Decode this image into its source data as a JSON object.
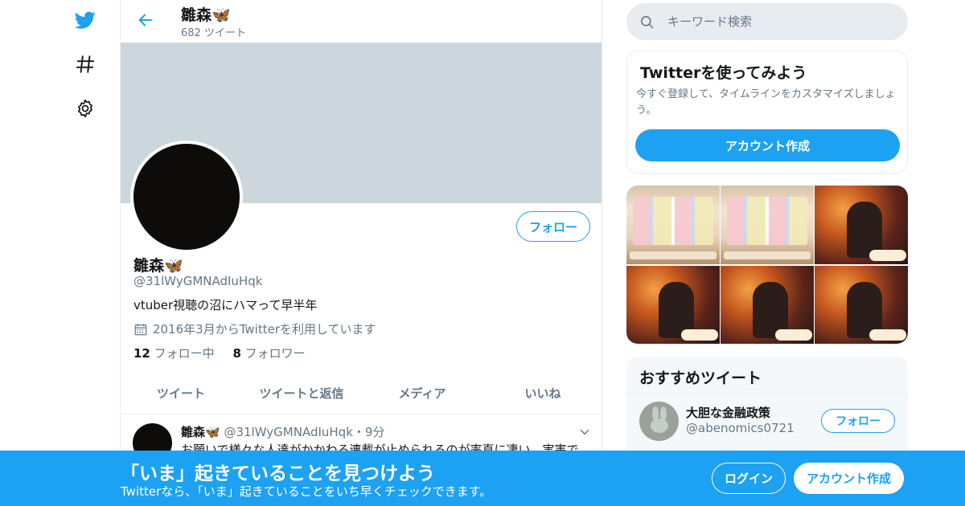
{
  "nav": {
    "items": [
      {
        "icon": "twitter-bird-icon"
      },
      {
        "icon": "hashtag-icon"
      },
      {
        "icon": "gear-icon"
      }
    ]
  },
  "header": {
    "name": "雛森🦋",
    "tweet_count": "682 ツイート"
  },
  "profile": {
    "name": "雛森🦋",
    "handle": "@31lWyGMNAdIuHqk",
    "bio": "vtuber視聴の沼にハマって早半年",
    "joined": "2016年3月からTwitterを利用しています",
    "following_count": "12",
    "following_label": "フォロー中",
    "followers_count": "8",
    "followers_label": "フォロワー",
    "follow_button": "フォロー"
  },
  "tabs": [
    "ツイート",
    "ツイートと返信",
    "メディア",
    "いいね"
  ],
  "tweet": {
    "name": "雛森🦋",
    "handle_time": "@31lWyGMNAdIuHqk・9分",
    "text": "お願いで様々な人達がかかわる連載が止められるのが率直に凄い。実害で"
  },
  "search": {
    "placeholder": "キーワード検索"
  },
  "signup_card": {
    "title": "Twitterを使ってみよう",
    "description": "今すぐ登録して、タイムラインをカスタマイズしましょう。",
    "button": "アカウント作成"
  },
  "media": {
    "tiles": [
      "cards",
      "cards",
      "fire",
      "fire",
      "fire",
      "fire"
    ]
  },
  "recommended": {
    "title": "おすすめツイート",
    "user_name": "大胆な金融政策",
    "user_handle": "@abenomics0721",
    "follow_button": "フォロー"
  },
  "bottom_bar": {
    "title": "「いま」起きていることを見つけよう",
    "subtitle": "Twitterなら、「いま」起きていることをいち早くチェックできます。",
    "login": "ログイン",
    "signup": "アカウント作成"
  },
  "colors": {
    "accent": "#1da1f2",
    "banner": "#ccd6dd",
    "text_secondary": "#657786"
  }
}
